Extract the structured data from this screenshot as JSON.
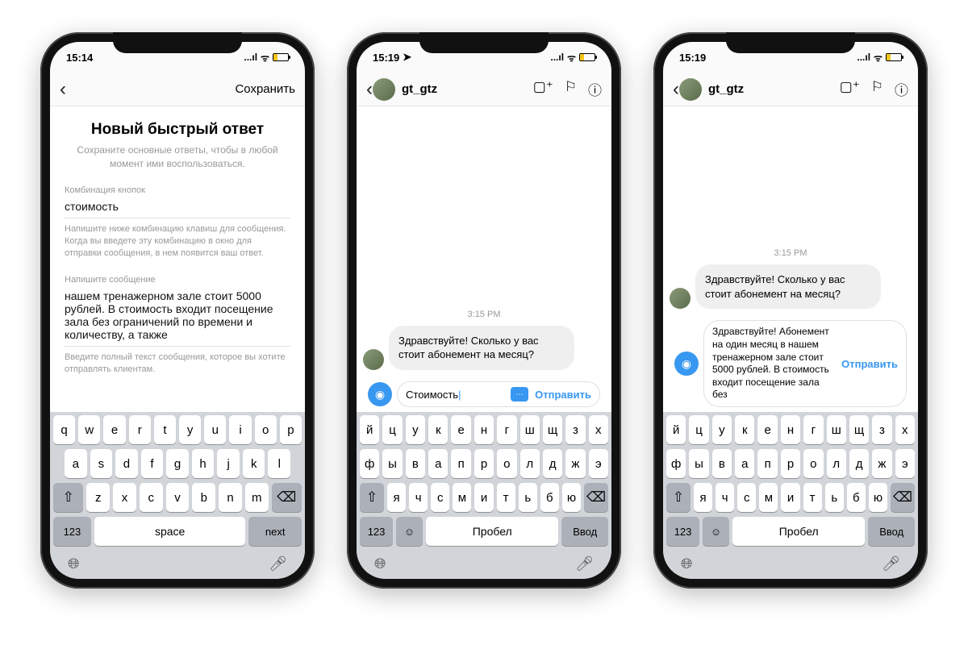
{
  "status": {
    "time1": "15:14",
    "time2": "15:19",
    "time3": "15:19",
    "signal": "...ıl",
    "wifi": "ᯤ"
  },
  "p1": {
    "save": "Сохранить",
    "title": "Новый быстрый ответ",
    "sub": "Сохраните основные ответы, чтобы в любой момент ими воспользоваться.",
    "f1label": "Комбинация кнопок",
    "f1val": "стоимость",
    "f1hint": "Напишите ниже комбинацию клавиш для сообщения. Когда вы введете эту комбинацию в окно для отправки сообщения, в нем появится ваш ответ.",
    "f2label": "Напишите сообщение",
    "f2val": "нашем тренажерном зале стоит 5000 рублей. В стоимость входит посещение зала без ограничений по времени и количеству, а также",
    "f2hint": "Введите полный текст сообщения, которое вы хотите отправлять клиентам."
  },
  "chat": {
    "user": "gt_gtz",
    "time": "3:15 PM",
    "msg1": "Здравствуйте! Сколько у вас стоит абонемент на месяц?",
    "input2": "Стоимость",
    "send": "Отправить",
    "msg3": "Здравствуйте! Абонемент на один месяц в нашем тренажерном зале стоит 5000 рублей. В стоимость входит посещение зала без"
  },
  "kb_en": {
    "r1": [
      "q",
      "w",
      "e",
      "r",
      "t",
      "y",
      "u",
      "i",
      "o",
      "p"
    ],
    "r2": [
      "a",
      "s",
      "d",
      "f",
      "g",
      "h",
      "j",
      "k",
      "l"
    ],
    "r3": [
      "z",
      "x",
      "c",
      "v",
      "b",
      "n",
      "m"
    ],
    "num": "123",
    "space": "space",
    "ret": "next"
  },
  "kb_ru": {
    "r1": [
      "й",
      "ц",
      "у",
      "к",
      "е",
      "н",
      "г",
      "ш",
      "щ",
      "з",
      "х"
    ],
    "r2": [
      "ф",
      "ы",
      "в",
      "а",
      "п",
      "р",
      "о",
      "л",
      "д",
      "ж",
      "э"
    ],
    "r3": [
      "я",
      "ч",
      "с",
      "м",
      "и",
      "т",
      "ь",
      "б",
      "ю"
    ],
    "num": "123",
    "space": "Пробел",
    "ret": "Ввод"
  }
}
